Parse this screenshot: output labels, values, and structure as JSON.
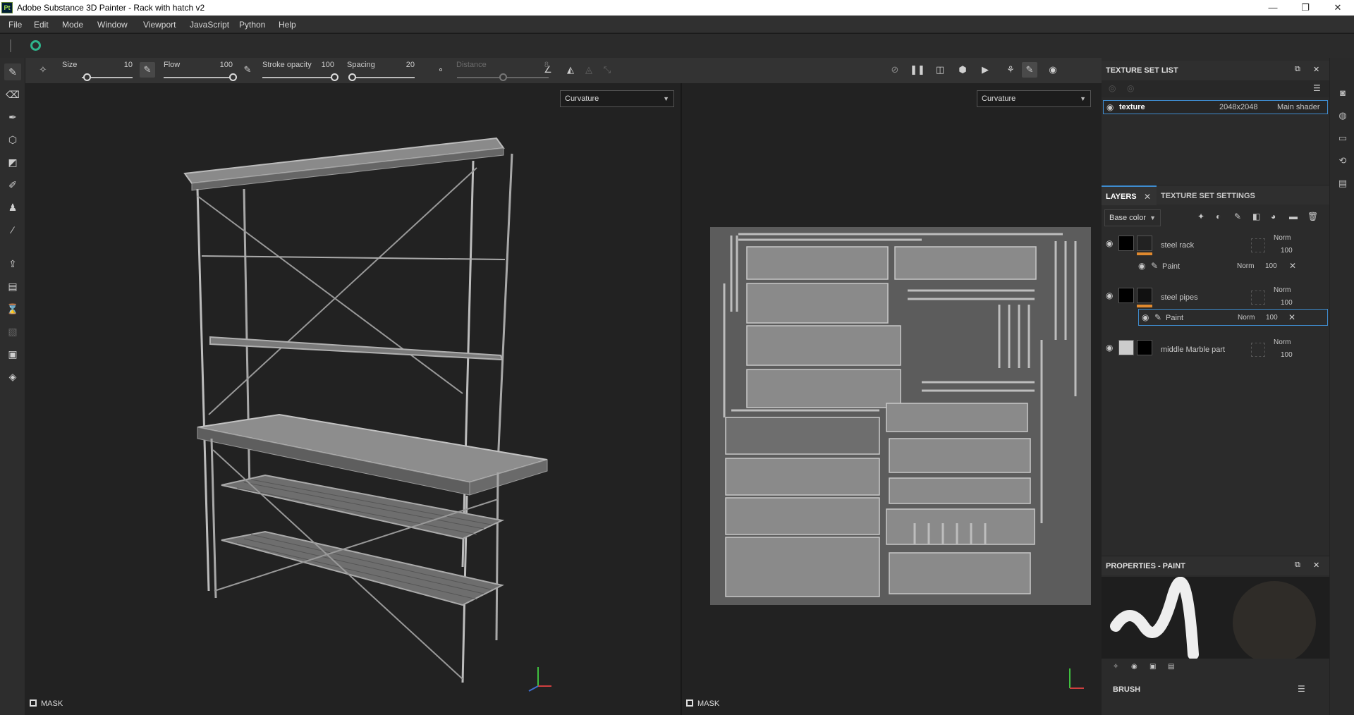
{
  "window": {
    "title": "Adobe Substance 3D Painter - Rack with hatch v2",
    "logo": "Pt",
    "minimize": "—",
    "restore": "❐",
    "close": "✕"
  },
  "menu": [
    "File",
    "Edit",
    "Mode",
    "Window",
    "Viewport",
    "JavaScript",
    "Python",
    "Help"
  ],
  "toolbar": {
    "size_label": "Size",
    "size_value": "10",
    "size_level": 0.1,
    "flow_label": "Flow",
    "flow_value": "100",
    "flow_level": 1.0,
    "opacity_label": "Stroke opacity",
    "opacity_value": "100",
    "opacity_level": 1.0,
    "spacing_label": "Spacing",
    "spacing_value": "20",
    "spacing_level": 0.05,
    "distance_label": "Distance",
    "distance_value": "8",
    "distance_level": 0.5
  },
  "viewport3d": {
    "mode": "Curvature",
    "mask_label": "MASK"
  },
  "viewport2d": {
    "mode": "Curvature",
    "mask_label": "MASK"
  },
  "texture_set_list": {
    "title": "TEXTURE SET LIST",
    "row": {
      "name": "texture",
      "resolution": "2048x2048",
      "shader": "Main shader"
    }
  },
  "layers": {
    "tab_layers": "LAYERS",
    "tab_tss": "TEXTURE SET SETTINGS",
    "channel": "Base color",
    "items": [
      {
        "name": "steel rack",
        "blend": "Norm",
        "opacity": "100",
        "sub": {
          "name": "Paint",
          "blend": "Norm",
          "opacity": "100"
        }
      },
      {
        "name": "steel pipes",
        "blend": "Norm",
        "opacity": "100",
        "sub": {
          "name": "Paint",
          "blend": "Norm",
          "opacity": "100"
        }
      },
      {
        "name": "middle Marble part",
        "blend": "Norm",
        "opacity": "100"
      }
    ]
  },
  "properties": {
    "title": "PROPERTIES - PAINT",
    "brush_label": "BRUSH"
  },
  "colors": {
    "accent": "#3f8ccf",
    "bg": "#222222",
    "panel": "#2b2b2b",
    "orange": "#e0892e"
  }
}
